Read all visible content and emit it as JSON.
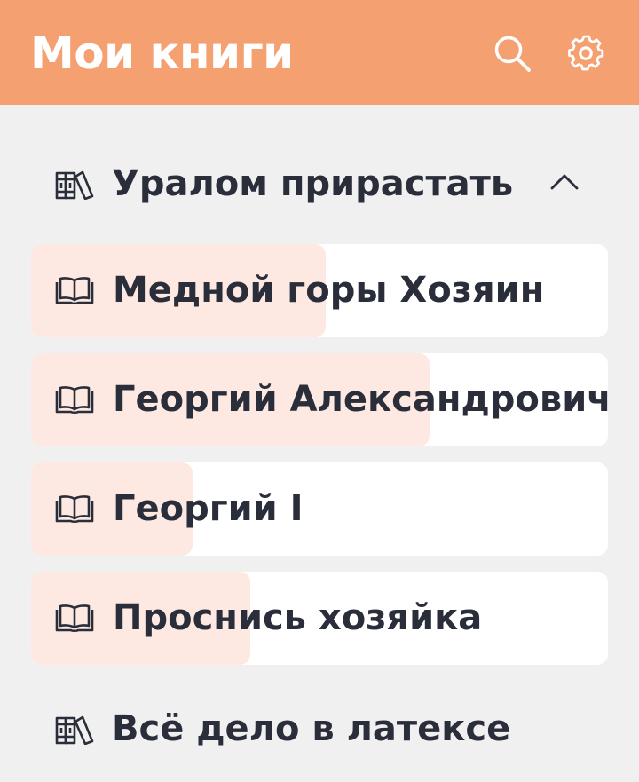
{
  "header": {
    "title": "Мои книги",
    "search_icon": "search-icon",
    "settings_icon": "gear-icon",
    "background": "#f4a070"
  },
  "groups": [
    {
      "label": "Уралом прирастать",
      "icon": "bookshelf-icon",
      "expanded": true,
      "books": [
        {
          "title": "Медной горы Хозяин",
          "icon": "open-book-icon",
          "progress": 0.51
        },
        {
          "title": "Георгий Александрович",
          "icon": "open-book-icon",
          "progress": 0.69
        },
        {
          "title": "Георгий I",
          "icon": "open-book-icon",
          "progress": 0.28
        },
        {
          "title": "Проснись хозяйка",
          "icon": "open-book-icon",
          "progress": 0.38
        }
      ]
    },
    {
      "label": "Всё дело в латексе",
      "icon": "bookshelf-icon",
      "expanded": false,
      "books": []
    }
  ],
  "colors": {
    "accent": "#f4a070",
    "progress_fill": "#fde9e1",
    "text": "#2a2d3a",
    "background": "#f0f0f0",
    "card": "#ffffff"
  }
}
